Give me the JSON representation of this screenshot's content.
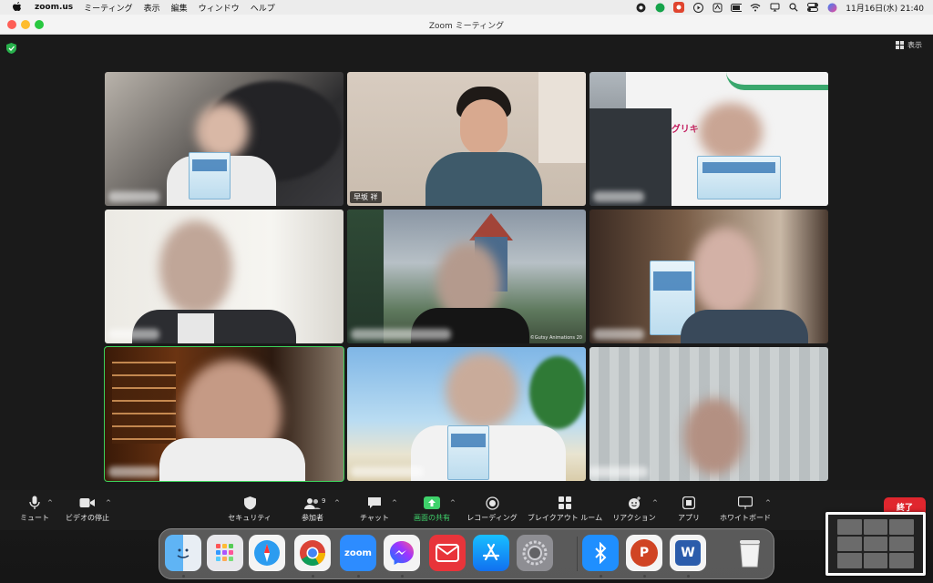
{
  "menubar": {
    "app_name": "zoom.us",
    "menus": [
      "ミーティング",
      "表示",
      "編集",
      "ウィンドウ",
      "ヘルプ"
    ],
    "clock": "11月16日(水) 21:40"
  },
  "window": {
    "title": "Zoom ミーティング",
    "view_button": "表示"
  },
  "participants": [
    {
      "name": "",
      "name_visible": false
    },
    {
      "name": "早坂 祥",
      "name_visible": true
    },
    {
      "name": "",
      "name_visible": false
    },
    {
      "name": "",
      "name_visible": false
    },
    {
      "name": "",
      "name_visible": false,
      "watermark": "©Gutsy Animations 20"
    },
    {
      "name": "",
      "name_visible": false
    },
    {
      "name": "",
      "name_visible": false,
      "active_speaker": true
    },
    {
      "name": "",
      "name_visible": false
    },
    {
      "name": "",
      "name_visible": false
    }
  ],
  "tile_texts": {
    "van_sign": "オグリキ",
    "book_title": "教師の学び2"
  },
  "controls": {
    "mute": "ミュート",
    "video": "ビデオの停止",
    "security": "セキュリティ",
    "participants": "参加者",
    "participants_count": "9",
    "chat": "チャット",
    "share": "画面の共有",
    "record": "レコーディング",
    "breakout": "ブレイクアウト ルーム",
    "reactions": "リアクション",
    "apps": "アプリ",
    "whiteboard": "ホワイトボード",
    "end": "終了"
  },
  "colors": {
    "active_speaker": "#3bd15a",
    "share_green": "#3fd26b",
    "end_red": "#e0262e"
  },
  "dock": {
    "apps": [
      "finder-icon",
      "launchpad-icon",
      "safari-icon",
      "chrome-icon",
      "zoom-icon",
      "messenger-icon",
      "mail-icon",
      "app-store-icon",
      "system-preferences-icon",
      "bluetooth-icon",
      "powerpoint-icon",
      "word-icon",
      "trash-icon"
    ],
    "zoom_label": "zoom",
    "powerpoint_letter": "P",
    "word_letter": "W"
  }
}
